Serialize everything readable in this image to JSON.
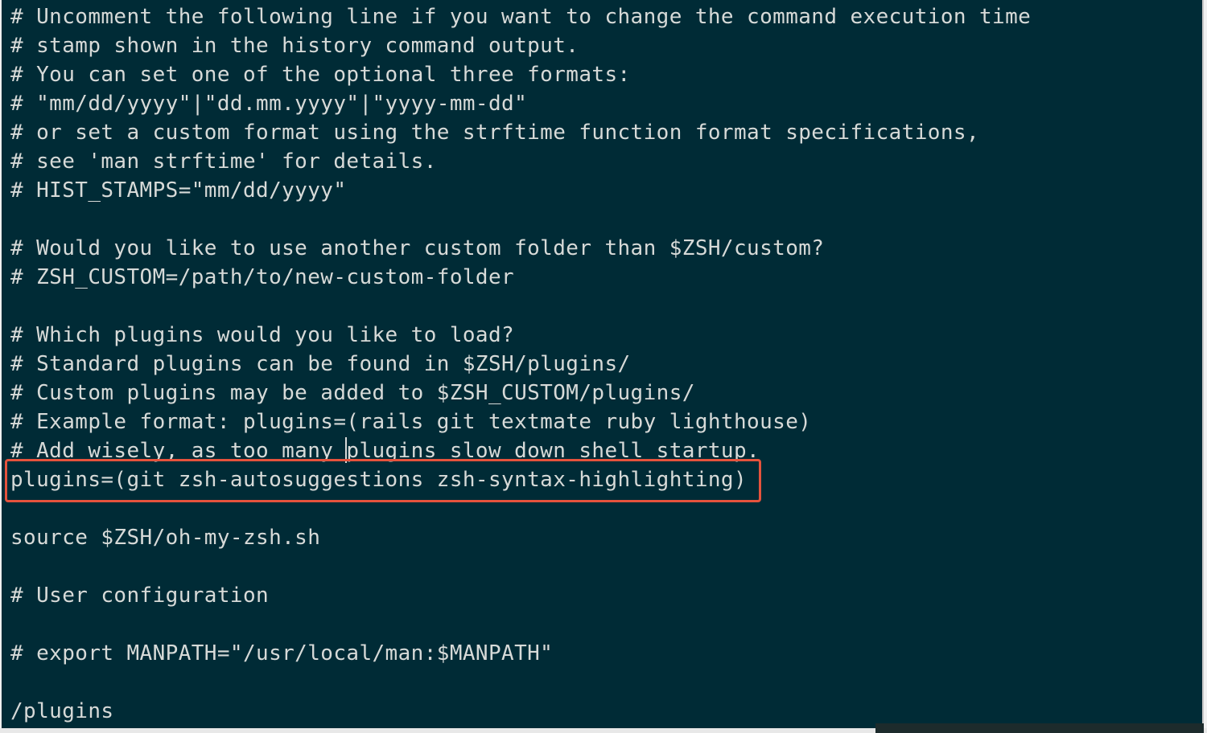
{
  "editor": {
    "lines": [
      "# Uncomment the following line if you want to change the command execution time",
      "# stamp shown in the history command output.",
      "# You can set one of the optional three formats:",
      "# \"mm/dd/yyyy\"|\"dd.mm.yyyy\"|\"yyyy-mm-dd\"",
      "# or set a custom format using the strftime function format specifications,",
      "# see 'man strftime' for details.",
      "# HIST_STAMPS=\"mm/dd/yyyy\"",
      "",
      "# Would you like to use another custom folder than $ZSH/custom?",
      "# ZSH_CUSTOM=/path/to/new-custom-folder",
      "",
      "# Which plugins would you like to load?",
      "# Standard plugins can be found in $ZSH/plugins/",
      "# Custom plugins may be added to $ZSH_CUSTOM/plugins/",
      "# Example format: plugins=(rails git textmate ruby lighthouse)",
      "# Add wisely, as too many plugins slow down shell startup.",
      "plugins=(git zsh-autosuggestions zsh-syntax-highlighting)",
      "",
      "source $ZSH/oh-my-zsh.sh",
      "",
      "# User configuration",
      "",
      "# export MANPATH=\"/usr/local/man:$MANPATH\"",
      "",
      "/plugins"
    ],
    "command_line": "/plugins"
  },
  "colors": {
    "background": "#002b36",
    "text": "#d7dad8",
    "highlight_border": "#e5533d"
  }
}
